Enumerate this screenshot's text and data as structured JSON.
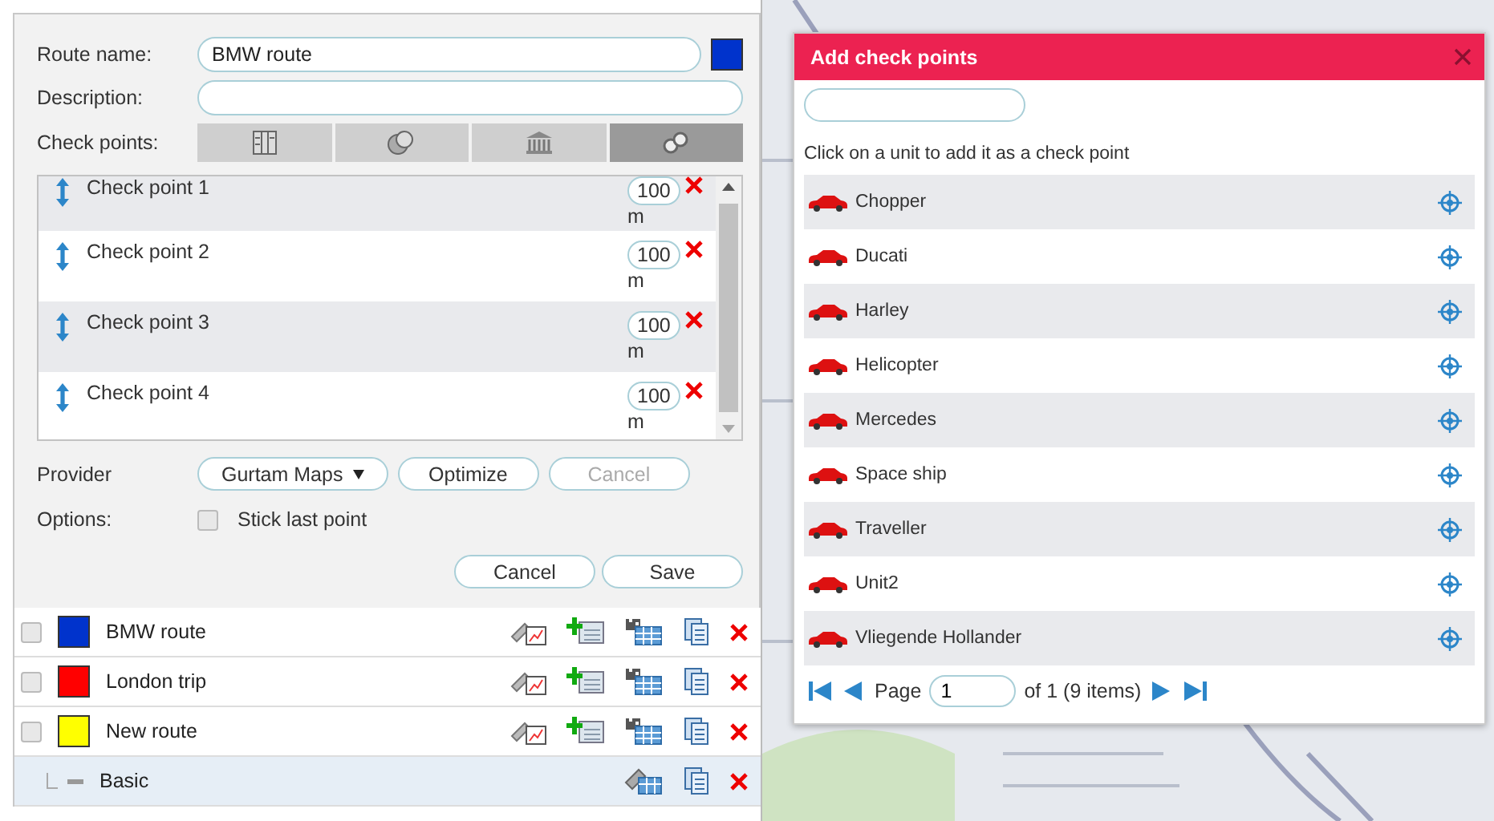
{
  "route_form": {
    "route_name_label": "Route name:",
    "route_name": "BMW route",
    "color": "#0033cc",
    "description_label": "Description:",
    "checkpoints_label": "Check points:",
    "checkpoint_tabs": [
      {
        "selected": false
      },
      {
        "selected": false
      },
      {
        "selected": false
      },
      {
        "selected": true
      }
    ],
    "checkpoints": [
      {
        "name": "Check point 1",
        "radius": "100",
        "unit": "m"
      },
      {
        "name": "Check point 2",
        "radius": "100",
        "unit": "m"
      },
      {
        "name": "Check point 3",
        "radius": "100",
        "unit": "m"
      },
      {
        "name": "Check point 4",
        "radius": "100",
        "unit": "m"
      }
    ],
    "provider_label": "Provider",
    "provider": "Gurtam Maps",
    "provider_buttons": [
      {
        "label": "Optimize",
        "disabled": false
      },
      {
        "label": "Cancel",
        "disabled": true
      }
    ],
    "options_label": "Options:",
    "stick_last_point": {
      "label": "Stick last point",
      "checked": false
    },
    "actions": [
      "Cancel",
      "Save"
    ]
  },
  "routes": [
    {
      "name": "BMW route",
      "color": "#0033cc",
      "checked": false
    },
    {
      "name": "London trip",
      "color": "#ff0000",
      "checked": false
    },
    {
      "name": "New route",
      "color": "#ffff00",
      "checked": false,
      "children": [
        {
          "name": "Basic"
        }
      ]
    }
  ],
  "dialog": {
    "title": "Add check points",
    "hint": "Click on a unit to add it as a check point",
    "units": [
      {
        "name": "Chopper"
      },
      {
        "name": "Ducati"
      },
      {
        "name": "Harley"
      },
      {
        "name": "Helicopter"
      },
      {
        "name": "Mercedes"
      },
      {
        "name": "Space ship"
      },
      {
        "name": "Traveller"
      },
      {
        "name": "Unit2"
      },
      {
        "name": "Vliegende Hollander"
      }
    ],
    "pagination": {
      "page_label": "Page",
      "page": "1",
      "total": "of 1 (9 items)"
    }
  }
}
